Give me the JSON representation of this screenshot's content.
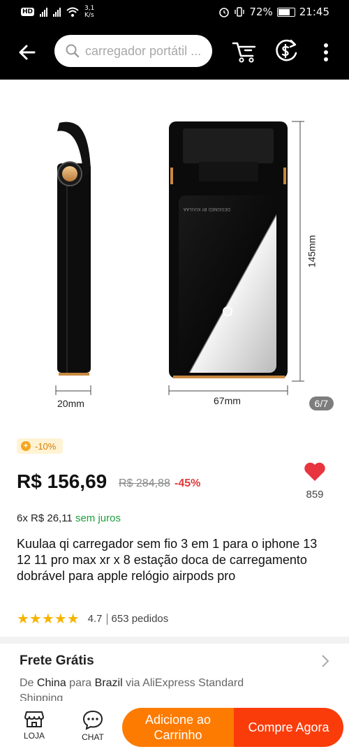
{
  "status_bar": {
    "hd_label": "HD",
    "speed": "3,1",
    "speed_unit": "K/s",
    "battery": "72%",
    "time": "21:45"
  },
  "topbar": {
    "search_placeholder": "carregador portátil ...",
    "icons": [
      "back-arrow-icon",
      "search-icon",
      "cart-icon",
      "coin-icon",
      "more-icon"
    ]
  },
  "gallery": {
    "pager": "6/7",
    "dimension_width_side": "20mm",
    "dimension_width_front": "67mm",
    "dimension_height": "145mm",
    "engraving": "DESIGNED BY KUULAA"
  },
  "product": {
    "coupon": "-10%",
    "price": "R$ 156,69",
    "old_price": "R$ 284,88",
    "discount": "-45%",
    "wishlist_count": "859",
    "installments": "6x R$ 26,11",
    "installments_note": "sem juros",
    "title": "Kuulaa qi carregador sem fio 3 em 1 para o iphone 13 12 11 pro max xr x 8 estação doca de carregamento dobrável para apple relógio airpods pro",
    "rating": "4.7",
    "orders": "653 pedidos",
    "stars": "★★★★★"
  },
  "shipping": {
    "heading": "Frete Grátis",
    "from_label": "De",
    "origin": "China",
    "to_label": "para",
    "destination": "Brazil",
    "via_label": "via AliExpress Standard Shipping"
  },
  "bottom_bar": {
    "store_label": "LOJA",
    "chat_label": "CHAT",
    "add_to_cart": "Adicione ao Carrinho",
    "buy_now": "Compre Agora"
  },
  "colors": {
    "accent_orange": "#fd7b00",
    "buy_red": "#fa3c0b",
    "discount_red": "#e03a3a",
    "green": "#1b9e3b",
    "star": "#f5b400"
  }
}
